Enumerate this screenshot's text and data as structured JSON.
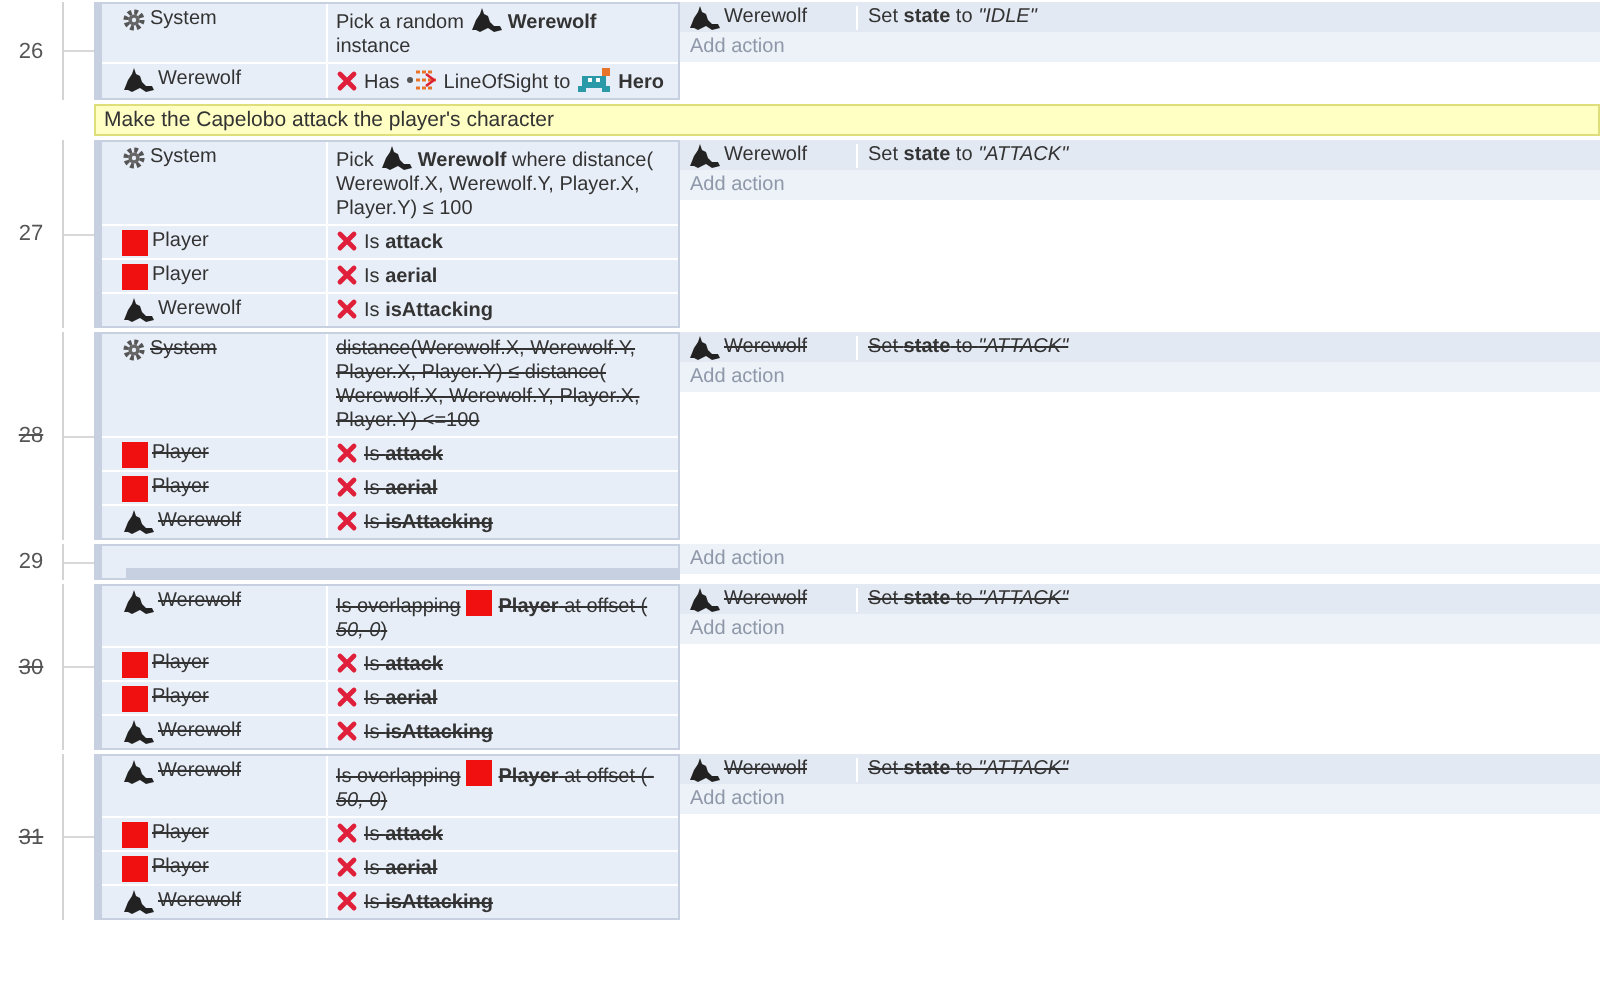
{
  "events": [
    {
      "kind": "event",
      "number": "26",
      "disabled": false,
      "conditions": [
        {
          "kind": "system",
          "object": "System",
          "negated": false,
          "parts": [
            {
              "kind": "text",
              "text": "Pick a random"
            },
            {
              "kind": "wolf"
            },
            {
              "kind": "text",
              "text": "Werewolf",
              "bold": true
            },
            {
              "kind": "text",
              "text": "instance"
            }
          ]
        },
        {
          "kind": "wolf",
          "object": "Werewolf",
          "negated": true,
          "parts": [
            {
              "kind": "text",
              "text": "Has"
            },
            {
              "kind": "beam"
            },
            {
              "kind": "text",
              "text": "LineOfSight to"
            },
            {
              "kind": "sprite"
            },
            {
              "kind": "text",
              "text": "Hero",
              "bold": true
            }
          ]
        }
      ],
      "actions": [
        {
          "kind": "wolf",
          "object": "Werewolf",
          "text": "Set **state** to *\"IDLE\"*"
        }
      ],
      "add_action": "Add action"
    },
    {
      "kind": "comment",
      "text": "Make the Capelobo attack the player's character"
    },
    {
      "kind": "event",
      "number": "27",
      "disabled": false,
      "conditions": [
        {
          "kind": "system",
          "object": "System",
          "negated": false,
          "parts": [
            {
              "kind": "text",
              "text": "Pick"
            },
            {
              "kind": "wolf"
            },
            {
              "kind": "text",
              "text": "**Werewolf** where distance("
            },
            {
              "kind": "text",
              "text": "Werewolf.X, Werewolf.Y, Player.X, Player.Y) ≤ 100"
            }
          ]
        },
        {
          "kind": "square",
          "object": "Player",
          "negated": true,
          "parts": [
            {
              "kind": "text",
              "text": "Is **attack**"
            }
          ]
        },
        {
          "kind": "square",
          "object": "Player",
          "negated": true,
          "parts": [
            {
              "kind": "text",
              "text": "Is **aerial**"
            }
          ]
        },
        {
          "kind": "wolf",
          "object": "Werewolf",
          "negated": true,
          "parts": [
            {
              "kind": "text",
              "text": "Is **isAttacking**"
            }
          ]
        }
      ],
      "actions": [
        {
          "kind": "wolf",
          "object": "Werewolf",
          "text": "Set **state** to *\"ATTACK\"*"
        }
      ],
      "add_action": "Add action"
    },
    {
      "kind": "event",
      "number": "28",
      "disabled": true,
      "conditions": [
        {
          "kind": "system",
          "object": "System",
          "negated": false,
          "parts": [
            {
              "kind": "text",
              "text": "distance(Werewolf.X, Werewolf.Y, Player.X, Player.Y) ≤ distance( Werewolf.X, Werewolf.Y, Player.X, Player.Y) <=100"
            }
          ]
        },
        {
          "kind": "square",
          "object": "Player",
          "negated": true,
          "parts": [
            {
              "kind": "text",
              "text": "Is **attack**"
            }
          ]
        },
        {
          "kind": "square",
          "object": "Player",
          "negated": true,
          "parts": [
            {
              "kind": "text",
              "text": "Is **aerial**"
            }
          ]
        },
        {
          "kind": "wolf",
          "object": "Werewolf",
          "negated": true,
          "parts": [
            {
              "kind": "text",
              "text": "Is **isAttacking**"
            }
          ]
        }
      ],
      "actions": [
        {
          "kind": "wolf",
          "object": "Werewolf",
          "text": "Set **state** to *\"ATTACK\"*"
        }
      ],
      "add_action": "Add action"
    },
    {
      "kind": "event",
      "number": "29",
      "disabled": false,
      "add_action": "Add action"
    },
    {
      "kind": "event",
      "number": "30",
      "disabled": true,
      "conditions": [
        {
          "kind": "wolf",
          "object": "Werewolf",
          "negated": false,
          "parts": [
            {
              "kind": "text",
              "text": "Is overlapping"
            },
            {
              "kind": "square"
            },
            {
              "kind": "text",
              "text": "**Player** at offset ("
            },
            {
              "kind": "text",
              "text": "50, 0",
              "italic": true
            },
            {
              "kind": "text",
              "text": ")"
            }
          ]
        },
        {
          "kind": "square",
          "object": "Player",
          "negated": true,
          "parts": [
            {
              "kind": "text",
              "text": "Is **attack**"
            }
          ]
        },
        {
          "kind": "square",
          "object": "Player",
          "negated": true,
          "parts": [
            {
              "kind": "text",
              "text": "Is **aerial**"
            }
          ]
        },
        {
          "kind": "wolf",
          "object": "Werewolf",
          "negated": true,
          "parts": [
            {
              "kind": "text",
              "text": "Is **isAttacking**"
            }
          ]
        }
      ],
      "actions": [
        {
          "kind": "wolf",
          "object": "Werewolf",
          "text": "Set **state** to *\"ATTACK\"*"
        }
      ],
      "add_action": "Add action"
    },
    {
      "kind": "event",
      "number": "31",
      "disabled": true,
      "conditions": [
        {
          "kind": "wolf",
          "object": "Werewolf",
          "negated": false,
          "parts": [
            {
              "kind": "text",
              "text": "Is overlapping"
            },
            {
              "kind": "square"
            },
            {
              "kind": "text",
              "text": "**Player** at offset (-"
            },
            {
              "kind": "text",
              "text": "50, 0",
              "italic": true
            },
            {
              "kind": "text",
              "text": ")"
            }
          ]
        },
        {
          "kind": "square",
          "object": "Player",
          "negated": true,
          "parts": [
            {
              "kind": "text",
              "text": "Is **attack**"
            }
          ]
        },
        {
          "kind": "square",
          "object": "Player",
          "negated": true,
          "parts": [
            {
              "kind": "text",
              "text": "Is **aerial**"
            }
          ]
        },
        {
          "kind": "wolf",
          "object": "Werewolf",
          "negated": true,
          "parts": [
            {
              "kind": "text",
              "text": "Is **isAttacking**"
            }
          ]
        }
      ],
      "actions": [
        {
          "kind": "wolf",
          "object": "Werewolf",
          "text": "Set **state** to *\"ATTACK\"*"
        }
      ],
      "add_action": "Add action"
    }
  ]
}
